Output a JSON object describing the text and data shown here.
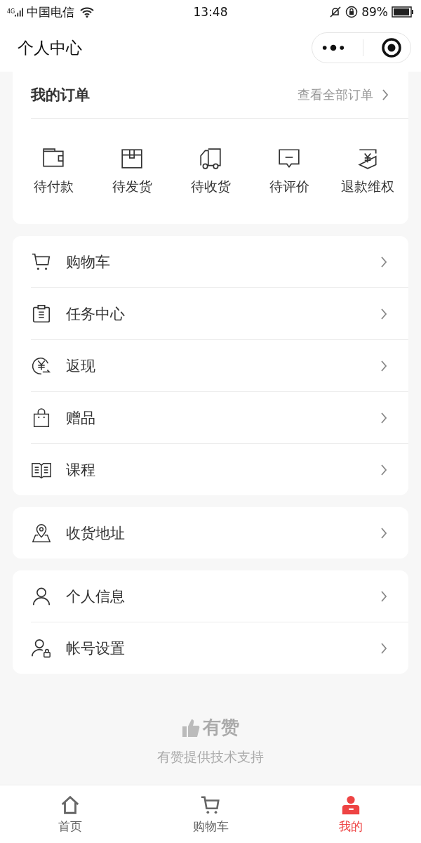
{
  "status_bar": {
    "network": "4G",
    "carrier": "中国电信",
    "time": "13:48",
    "battery": "89%"
  },
  "nav_bar": {
    "title": "个人中心"
  },
  "orders": {
    "title": "我的订单",
    "link": "查看全部订单",
    "items": [
      {
        "label": "待付款"
      },
      {
        "label": "待发货"
      },
      {
        "label": "待收货"
      },
      {
        "label": "待评价"
      },
      {
        "label": "退款维权"
      }
    ]
  },
  "menu_groups": [
    {
      "items": [
        {
          "label": "购物车"
        },
        {
          "label": "任务中心"
        },
        {
          "label": "返现"
        },
        {
          "label": "赠品"
        },
        {
          "label": "课程"
        }
      ]
    },
    {
      "items": [
        {
          "label": "收货地址"
        }
      ]
    },
    {
      "items": [
        {
          "label": "个人信息"
        },
        {
          "label": "帐号设置"
        }
      ]
    }
  ],
  "footer": {
    "logo": "有赞",
    "text": "有赞提供技术支持"
  },
  "tab_bar": [
    {
      "label": "首页",
      "selected": false
    },
    {
      "label": "购物车",
      "selected": false
    },
    {
      "label": "我的",
      "selected": true
    }
  ]
}
